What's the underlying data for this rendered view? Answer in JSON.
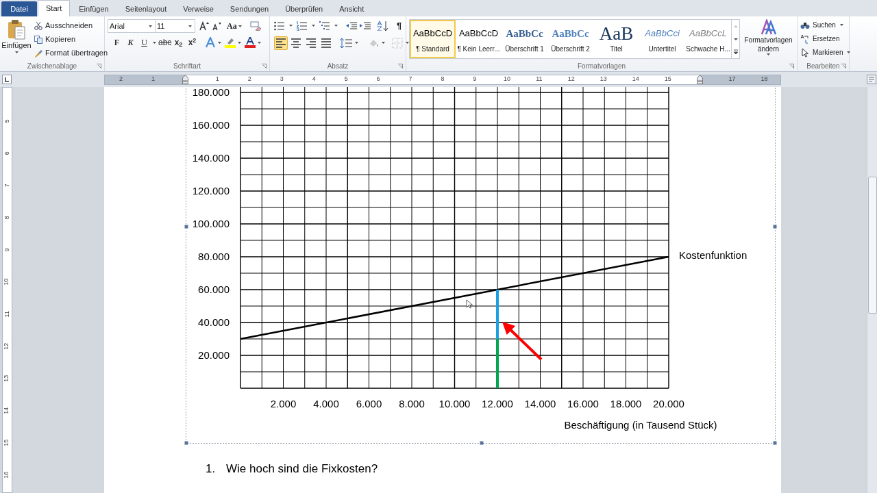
{
  "tabs": [
    {
      "label": "Datei",
      "kind": "file",
      "selected": false
    },
    {
      "label": "Start",
      "kind": "tab",
      "selected": true
    },
    {
      "label": "Einfügen",
      "kind": "tab",
      "selected": false
    },
    {
      "label": "Seitenlayout",
      "kind": "tab",
      "selected": false
    },
    {
      "label": "Verweise",
      "kind": "tab",
      "selected": false
    },
    {
      "label": "Sendungen",
      "kind": "tab",
      "selected": false
    },
    {
      "label": "Überprüfen",
      "kind": "tab",
      "selected": false
    },
    {
      "label": "Ansicht",
      "kind": "tab",
      "selected": false
    }
  ],
  "clipboard": {
    "paste": "Einfügen",
    "items": [
      "Ausschneiden",
      "Kopieren",
      "Format übertragen"
    ],
    "label": "Zwischenablage"
  },
  "font": {
    "name": "Arial",
    "size": "11",
    "case": "Aa",
    "buttons": [
      "F",
      "K",
      "U",
      "abc",
      "x$_{2}$",
      "x$^{2}$"
    ],
    "label": "Schriftart"
  },
  "paragraph": {
    "pilcrow": "¶",
    "align": [
      {
        "kind": "left",
        "selected": true
      },
      {
        "kind": "center",
        "selected": false
      },
      {
        "kind": "right",
        "selected": false
      },
      {
        "kind": "justify",
        "selected": false
      }
    ],
    "label": "Absatz"
  },
  "styles": {
    "items": [
      {
        "preview": "AaBbCcD",
        "label": "¶ Standard",
        "kind": "normal",
        "selected": true
      },
      {
        "preview": "AaBbCcD",
        "label": "¶ Kein Leerr...",
        "kind": "normal",
        "selected": false
      },
      {
        "preview": "AaBbCc",
        "label": "Überschrift 1",
        "kind": "heading1",
        "selected": false
      },
      {
        "preview": "AaBbCc",
        "label": "Überschrift 2",
        "kind": "heading2",
        "selected": false
      },
      {
        "preview": "AaB",
        "label": "Titel",
        "kind": "title",
        "selected": false
      },
      {
        "preview": "AaBbCci",
        "label": "Untertitel",
        "kind": "subtitle",
        "selected": false
      },
      {
        "preview": "AaBbCcL",
        "label": "Schwache H...",
        "kind": "emphasis",
        "selected": false
      }
    ],
    "change_button": "Formatvorlagen ändern",
    "label": "Formatvorlagen"
  },
  "editing": {
    "items": [
      "Suchen",
      "Ersetzen",
      "Markieren"
    ],
    "label": "Bearbeiten"
  },
  "ruler": {
    "labels": [
      "2",
      "1",
      "1",
      "2",
      "3",
      "4",
      "5",
      "6",
      "7",
      "8",
      "9",
      "10",
      "11",
      "12",
      "13",
      "14",
      "15",
      "17",
      "18"
    ],
    "vertical_labels": [
      "5",
      "6",
      "7",
      "8",
      "9",
      "10",
      "11",
      "12",
      "13",
      "14",
      "15",
      "16"
    ]
  },
  "chart_data": {
    "type": "line",
    "xlabel": "Beschäftigung (in Tausend Stück)",
    "x": [
      0,
      20000
    ],
    "series": [
      {
        "name": "Kostenfunktion",
        "color": "#000000",
        "values": [
          30000,
          80000
        ]
      }
    ],
    "xlim": [
      0,
      20000
    ],
    "ylim": [
      0,
      183333
    ],
    "grid": true,
    "xticks": [
      {
        "value": 2000,
        "label": "2.000"
      },
      {
        "value": 4000,
        "label": "4.000"
      },
      {
        "value": 6000,
        "label": "6.000"
      },
      {
        "value": 8000,
        "label": "8.000"
      },
      {
        "value": 10000,
        "label": "10.000"
      },
      {
        "value": 12000,
        "label": "12.000"
      },
      {
        "value": 14000,
        "label": "14.000"
      },
      {
        "value": 16000,
        "label": "16.000"
      },
      {
        "value": 18000,
        "label": "18.000"
      },
      {
        "value": 20000,
        "label": "20.000"
      }
    ],
    "yticks": [
      {
        "value": 20000,
        "label": "20.000"
      },
      {
        "value": 40000,
        "label": "40.000"
      },
      {
        "value": 60000,
        "label": "60.000"
      },
      {
        "value": 80000,
        "label": "80.000"
      },
      {
        "value": 100000,
        "label": "100.000"
      },
      {
        "value": 120000,
        "label": "120.000"
      },
      {
        "value": 140000,
        "label": "140.000"
      },
      {
        "value": 160000,
        "label": "160.000"
      },
      {
        "value": 180000,
        "label": "180.000"
      }
    ]
  },
  "chart_marks": [
    {
      "kind": "segment",
      "color": "#1ba1e2"
    },
    {
      "kind": "segment",
      "color": "#00a650"
    },
    {
      "kind": "arrow",
      "color": "#ff0000"
    }
  ],
  "questions": [
    {
      "number": "1.",
      "text": "Wie hoch sind die Fixkosten?"
    }
  ]
}
